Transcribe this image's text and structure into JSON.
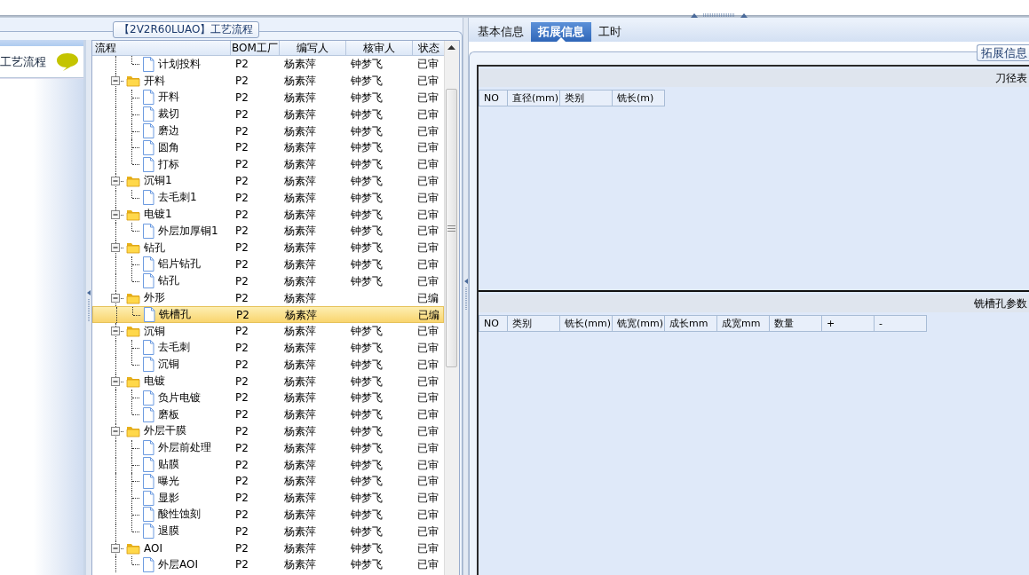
{
  "sidebar": {
    "item": {
      "label": "工艺流程"
    }
  },
  "group_title": "【2V2R60LUAO】工艺流程",
  "grid": {
    "columns": [
      "流程",
      "BOM工厂",
      "编写人",
      "核审人",
      "状态"
    ],
    "rows": [
      {
        "children": [
          {
            "name": "计划投料",
            "kind": "file",
            "bom": "P2",
            "writer": "杨素萍",
            "reviewer": "钟梦飞",
            "status": "已审",
            "selected": false
          }
        ]
      },
      {
        "name": "开料",
        "kind": "folder",
        "expanded": true,
        "bom": "P2",
        "writer": "杨素萍",
        "reviewer": "钟梦飞",
        "status": "已审",
        "selected": false,
        "children": [
          {
            "name": "开料",
            "kind": "file",
            "bom": "P2",
            "writer": "杨素萍",
            "reviewer": "钟梦飞",
            "status": "已审",
            "selected": false
          },
          {
            "name": "裁切",
            "kind": "file",
            "bom": "P2",
            "writer": "杨素萍",
            "reviewer": "钟梦飞",
            "status": "已审",
            "selected": false
          },
          {
            "name": "磨边",
            "kind": "file",
            "bom": "P2",
            "writer": "杨素萍",
            "reviewer": "钟梦飞",
            "status": "已审",
            "selected": false
          },
          {
            "name": "圆角",
            "kind": "file",
            "bom": "P2",
            "writer": "杨素萍",
            "reviewer": "钟梦飞",
            "status": "已审",
            "selected": false
          },
          {
            "name": "打标",
            "kind": "file",
            "bom": "P2",
            "writer": "杨素萍",
            "reviewer": "钟梦飞",
            "status": "已审",
            "selected": false
          }
        ]
      },
      {
        "name": "沉铜1",
        "kind": "folder",
        "expanded": true,
        "bom": "P2",
        "writer": "杨素萍",
        "reviewer": "钟梦飞",
        "status": "已审",
        "selected": false,
        "children": [
          {
            "name": "去毛刺1",
            "kind": "file",
            "bom": "P2",
            "writer": "杨素萍",
            "reviewer": "钟梦飞",
            "status": "已审",
            "selected": false
          }
        ]
      },
      {
        "name": "电镀1",
        "kind": "folder",
        "expanded": true,
        "bom": "P2",
        "writer": "杨素萍",
        "reviewer": "钟梦飞",
        "status": "已审",
        "selected": false,
        "children": [
          {
            "name": "外层加厚铜1",
            "kind": "file",
            "bom": "P2",
            "writer": "杨素萍",
            "reviewer": "钟梦飞",
            "status": "已审",
            "selected": false
          }
        ]
      },
      {
        "name": "钻孔",
        "kind": "folder",
        "expanded": true,
        "bom": "P2",
        "writer": "杨素萍",
        "reviewer": "钟梦飞",
        "status": "已审",
        "selected": false,
        "children": [
          {
            "name": "铝片钻孔",
            "kind": "file",
            "bom": "P2",
            "writer": "杨素萍",
            "reviewer": "钟梦飞",
            "status": "已审",
            "selected": false
          },
          {
            "name": "钻孔",
            "kind": "file",
            "bom": "P2",
            "writer": "杨素萍",
            "reviewer": "钟梦飞",
            "status": "已审",
            "selected": false
          }
        ]
      },
      {
        "name": "外形",
        "kind": "folder",
        "expanded": true,
        "bom": "P2",
        "writer": "杨素萍",
        "status": "已编",
        "selected": false,
        "children": [
          {
            "name": "铣槽孔",
            "kind": "file",
            "bom": "P2",
            "writer": "杨素萍",
            "status": "已编",
            "selected": true
          }
        ]
      },
      {
        "name": "沉铜",
        "kind": "folder",
        "expanded": true,
        "bom": "P2",
        "writer": "杨素萍",
        "reviewer": "钟梦飞",
        "status": "已审",
        "selected": false,
        "children": [
          {
            "name": "去毛刺",
            "kind": "file",
            "bom": "P2",
            "writer": "杨素萍",
            "reviewer": "钟梦飞",
            "status": "已审",
            "selected": false
          },
          {
            "name": "沉铜",
            "kind": "file",
            "bom": "P2",
            "writer": "杨素萍",
            "reviewer": "钟梦飞",
            "status": "已审",
            "selected": false
          }
        ]
      },
      {
        "name": "电镀",
        "kind": "folder",
        "expanded": true,
        "bom": "P2",
        "writer": "杨素萍",
        "reviewer": "钟梦飞",
        "status": "已审",
        "selected": false,
        "children": [
          {
            "name": "负片电镀",
            "kind": "file",
            "bom": "P2",
            "writer": "杨素萍",
            "reviewer": "钟梦飞",
            "status": "已审",
            "selected": false
          },
          {
            "name": "磨板",
            "kind": "file",
            "bom": "P2",
            "writer": "杨素萍",
            "reviewer": "钟梦飞",
            "status": "已审",
            "selected": false
          }
        ]
      },
      {
        "name": "外层干膜",
        "kind": "folder",
        "expanded": true,
        "bom": "P2",
        "writer": "杨素萍",
        "reviewer": "钟梦飞",
        "status": "已审",
        "selected": false,
        "children": [
          {
            "name": "外层前处理",
            "kind": "file",
            "bom": "P2",
            "writer": "杨素萍",
            "reviewer": "钟梦飞",
            "status": "已审",
            "selected": false
          },
          {
            "name": "贴膜",
            "kind": "file",
            "bom": "P2",
            "writer": "杨素萍",
            "reviewer": "钟梦飞",
            "status": "已审",
            "selected": false
          },
          {
            "name": "曝光",
            "kind": "file",
            "bom": "P2",
            "writer": "杨素萍",
            "reviewer": "钟梦飞",
            "status": "已审",
            "selected": false
          },
          {
            "name": "显影",
            "kind": "file",
            "bom": "P2",
            "writer": "杨素萍",
            "reviewer": "钟梦飞",
            "status": "已审",
            "selected": false
          },
          {
            "name": "酸性蚀刻",
            "kind": "file",
            "bom": "P2",
            "writer": "杨素萍",
            "reviewer": "钟梦飞",
            "status": "已审",
            "selected": false
          },
          {
            "name": "退膜",
            "kind": "file",
            "bom": "P2",
            "writer": "杨素萍",
            "reviewer": "钟梦飞",
            "status": "已审",
            "selected": false
          }
        ]
      },
      {
        "name": "AOI",
        "kind": "folder",
        "expanded": true,
        "bom": "P2",
        "writer": "杨素萍",
        "reviewer": "钟梦飞",
        "status": "已审",
        "selected": false,
        "children": [
          {
            "name": "外层AOI",
            "kind": "file",
            "bom": "P2",
            "writer": "杨素萍",
            "reviewer": "钟梦飞",
            "status": "已审",
            "selected": false
          }
        ]
      }
    ]
  },
  "tabs": [
    {
      "label": "基本信息",
      "selected": false
    },
    {
      "label": "拓展信息",
      "selected": true
    },
    {
      "label": "工时",
      "selected": false
    }
  ],
  "tab_panel": {
    "group_label": "拓展信息",
    "tables": [
      {
        "title": "刀径表",
        "columns": [
          "NO",
          "直径(mm)",
          "类别",
          "铣长(m)"
        ]
      },
      {
        "title": "铣槽孔参数",
        "columns": [
          "NO",
          "类别",
          "铣长(mm)",
          "铣宽(mm)",
          "成长mm",
          "成宽mm",
          "数量",
          "+",
          "-"
        ]
      }
    ]
  }
}
